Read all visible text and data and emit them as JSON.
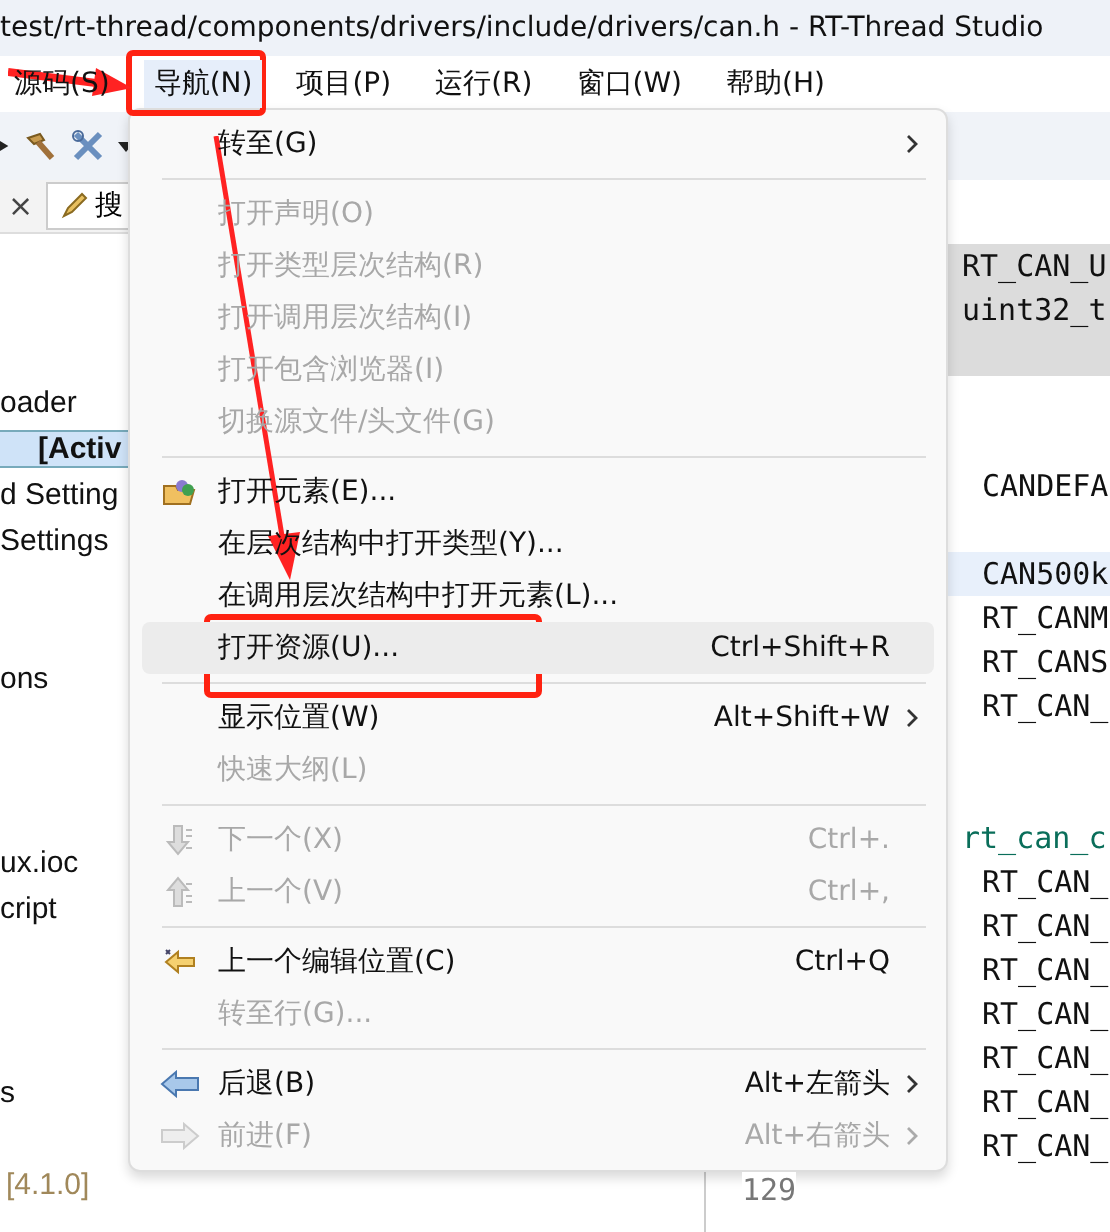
{
  "window": {
    "title": "test/rt-thread/components/drivers/include/drivers/can.h - RT-Thread Studio"
  },
  "menu_bar": [
    {
      "label": "源码(S)",
      "selected": false
    },
    {
      "label": "导航(N)",
      "selected": true
    },
    {
      "label": "项目(P)",
      "selected": false
    },
    {
      "label": "运行(R)",
      "selected": false
    },
    {
      "label": "窗口(W)",
      "selected": false
    },
    {
      "label": "帮助(H)",
      "selected": false
    }
  ],
  "tabs": [
    {
      "kind": "close",
      "label": "×"
    },
    {
      "kind": "search",
      "label": "搜"
    }
  ],
  "tree": [
    {
      "kind": "blank"
    },
    {
      "kind": "blank"
    },
    {
      "kind": "blank"
    },
    {
      "kind": "item",
      "label": "oader",
      "selected": false
    },
    {
      "kind": "item",
      "label": "[Activ",
      "selected": true
    },
    {
      "kind": "item",
      "label": "d Setting",
      "selected": false
    },
    {
      "kind": "item",
      "label": "Settings",
      "selected": false
    },
    {
      "kind": "blank"
    },
    {
      "kind": "blank"
    },
    {
      "kind": "item",
      "label": "ons",
      "selected": false
    },
    {
      "kind": "blank"
    },
    {
      "kind": "blank"
    },
    {
      "kind": "blank"
    },
    {
      "kind": "item",
      "label": "ux.ioc",
      "selected": false
    },
    {
      "kind": "item",
      "label": "cript",
      "selected": false
    },
    {
      "kind": "blank"
    },
    {
      "kind": "blank"
    },
    {
      "kind": "blank"
    },
    {
      "kind": "item",
      "label": "s",
      "selected": false
    },
    {
      "kind": "blank"
    },
    {
      "kind": "version",
      "label": "[4.1.0]",
      "selected": false
    }
  ],
  "editor": {
    "lines": [
      {
        "kind": "shaded",
        "text": "RT_CAN_U",
        "indented": false
      },
      {
        "kind": "shaded",
        "text": "uint32_t",
        "indented": false
      },
      {
        "kind": "shaded-blank"
      },
      {
        "kind": "blank"
      },
      {
        "kind": "blank"
      },
      {
        "kind": "code",
        "text": "CANDEFA",
        "indented": true
      },
      {
        "kind": "blank"
      },
      {
        "kind": "current",
        "text": "CAN500k",
        "indented": true
      },
      {
        "kind": "code",
        "text": "RT_CANM",
        "indented": true
      },
      {
        "kind": "code",
        "text": "RT_CANS",
        "indented": true
      },
      {
        "kind": "code",
        "text": "RT_CAN_",
        "indented": true
      },
      {
        "kind": "blank"
      },
      {
        "kind": "blank"
      },
      {
        "kind": "type",
        "text": "rt_can_c",
        "indented": false
      },
      {
        "kind": "code",
        "text": "RT_CAN_",
        "indented": true
      },
      {
        "kind": "code",
        "text": "RT_CAN_",
        "indented": true
      },
      {
        "kind": "code",
        "text": "RT_CAN_",
        "indented": true
      },
      {
        "kind": "code",
        "text": "RT_CAN_",
        "indented": true
      },
      {
        "kind": "code",
        "text": "RT_CAN_",
        "indented": true
      },
      {
        "kind": "code",
        "text": "RT_CAN_",
        "indented": true
      },
      {
        "kind": "code",
        "text": "RT_CAN_",
        "indented": true
      }
    ],
    "line_number": "129"
  },
  "menu": [
    {
      "kind": "item",
      "label": "转至(G)",
      "submenu": true,
      "disabled": false
    },
    {
      "kind": "separator"
    },
    {
      "kind": "item",
      "label": "打开声明(O)",
      "disabled": true
    },
    {
      "kind": "item",
      "label": "打开类型层次结构(R)",
      "disabled": true
    },
    {
      "kind": "item",
      "label": "打开调用层次结构(I)",
      "disabled": true
    },
    {
      "kind": "item",
      "label": "打开包含浏览器(I)",
      "disabled": true
    },
    {
      "kind": "item",
      "label": "切换源文件/头文件(G)",
      "disabled": true
    },
    {
      "kind": "separator"
    },
    {
      "kind": "item",
      "label": "打开元素(E)...",
      "disabled": false
    },
    {
      "kind": "item",
      "label": "在层次结构中打开类型(Y)...",
      "disabled": false
    },
    {
      "kind": "item",
      "label": "在调用层次结构中打开元素(L)...",
      "disabled": false
    },
    {
      "kind": "item",
      "label": "打开资源(U)...",
      "shortcut": "Ctrl+Shift+R",
      "disabled": false,
      "highlighted": true
    },
    {
      "kind": "separator"
    },
    {
      "kind": "item",
      "label": "显示位置(W)",
      "shortcut": "Alt+Shift+W",
      "submenu": true,
      "disabled": false
    },
    {
      "kind": "item",
      "label": "快速大纲(L)",
      "disabled": true
    },
    {
      "kind": "separator"
    },
    {
      "kind": "item",
      "label": "下一个(X)",
      "shortcut": "Ctrl+.",
      "disabled": true
    },
    {
      "kind": "item",
      "label": "上一个(V)",
      "shortcut": "Ctrl+,",
      "disabled": true
    },
    {
      "kind": "separator"
    },
    {
      "kind": "item",
      "label": "上一个编辑位置(C)",
      "shortcut": "Ctrl+Q",
      "disabled": false
    },
    {
      "kind": "item",
      "label": "转至行(G)...",
      "disabled": true
    },
    {
      "kind": "separator"
    },
    {
      "kind": "item",
      "label": "后退(B)",
      "shortcut": "Alt+左箭头",
      "submenu": true,
      "disabled": false
    },
    {
      "kind": "item",
      "label": "前进(F)",
      "shortcut": "Alt+右箭头",
      "submenu": true,
      "disabled": true
    }
  ]
}
